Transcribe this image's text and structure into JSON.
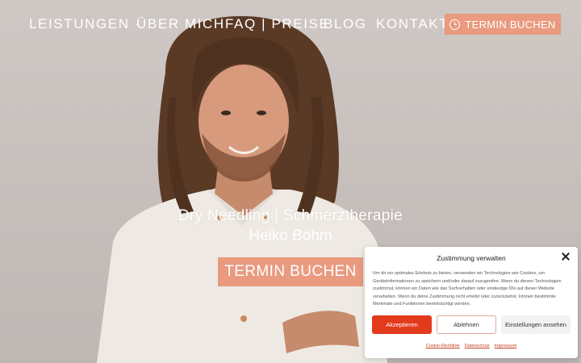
{
  "nav": {
    "items": [
      {
        "label": "LEISTUNGEN",
        "has_dropdown": true
      },
      {
        "label": "ÜBER MICH"
      },
      {
        "label": "FAQ | PREISE"
      },
      {
        "label": "BLOG"
      },
      {
        "label": "KONTAKT"
      }
    ],
    "dropdown_glyph": "⌄",
    "cta": {
      "label": "TERMIN BUCHEN",
      "icon": "clock-icon"
    }
  },
  "hero": {
    "title": "Dry Needling | Schmerztherapie",
    "subtitle": "Heiko Böhm",
    "cta_label": "TERMIN BUCHEN",
    "image": "portrait-photo"
  },
  "consent": {
    "title": "Zustimmung verwalten",
    "text": "Um dir ein optimales Erlebnis zu bieten, verwenden wir Technologien wie Cookies, um Geräteinformationen zu speichern und/oder darauf zuzugreifen. Wenn du diesen Technologien zustimmst, können wir Daten wie das Surfverhalten oder eindeutige IDs auf dieser Website verarbeiten. Wenn du deine Zustimmung nicht erteilst oder zurückziehst, können bestimmte Merkmale und Funktionen beeinträchtigt werden.",
    "accept_label": "Akzeptieren",
    "deny_label": "Ablehnen",
    "settings_label": "Einstellungen ansehen",
    "links": [
      "Cookie-Richtlinie",
      "Datenschutz",
      "Impressum"
    ]
  },
  "colors": {
    "accent": "#e99a7f",
    "accept": "#e33a1c",
    "link": "#c2431f",
    "background": "#c9c2bf"
  }
}
